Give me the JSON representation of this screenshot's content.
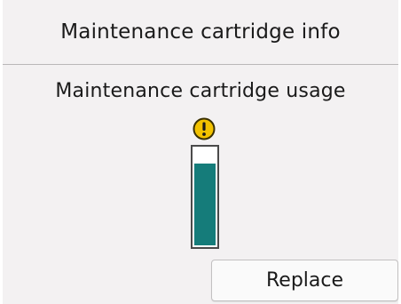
{
  "header": {
    "title": "Maintenance cartridge info"
  },
  "main": {
    "usage_label": "Maintenance cartridge usage",
    "warning_icon": "exclamation-warning-icon",
    "gauge": {
      "level_fraction": 0.84,
      "fill_color": "#157c7a"
    }
  },
  "actions": {
    "replace_label": "Replace"
  },
  "colors": {
    "warning": "#f2c200",
    "background": "#f3f1f2"
  }
}
